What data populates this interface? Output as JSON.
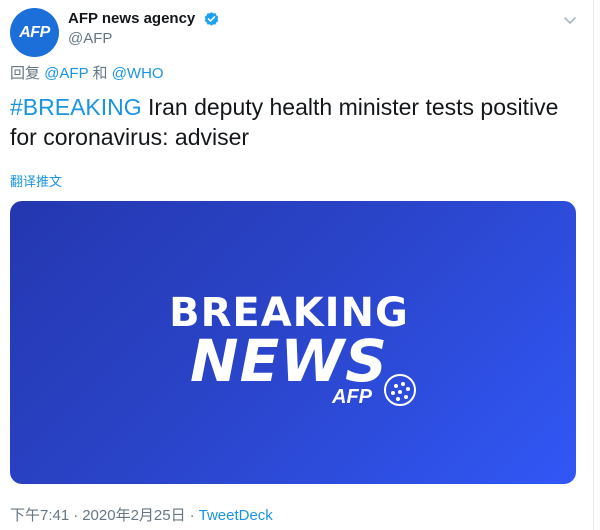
{
  "account": {
    "display_name": "AFP news agency",
    "handle": "@AFP",
    "avatar_text": "AFP",
    "avatar_color": "#1c6fd8"
  },
  "reply": {
    "prefix": "回复",
    "user1": "@AFP",
    "conj": "和",
    "user2": "@WHO"
  },
  "tweet": {
    "hashtag": "#BREAKING",
    "text": " Iran deputy health minister tests positive for coronavirus: adviser",
    "translate_label": "翻译推文"
  },
  "media": {
    "line1": "BREAKING",
    "line2": "NEWS",
    "logo": "AFP",
    "gradient_start": "#2437b0",
    "gradient_end": "#3157f6"
  },
  "footer": {
    "time": "下午7:41",
    "date": "2020年2月25日",
    "separator": "·",
    "source": "TweetDeck"
  },
  "colors": {
    "link": "#1b95e0",
    "secondary": "#657786",
    "primary_text": "#14171a"
  },
  "icons": {
    "verified": "verified-badge-icon",
    "menu": "chevron-down-icon"
  }
}
